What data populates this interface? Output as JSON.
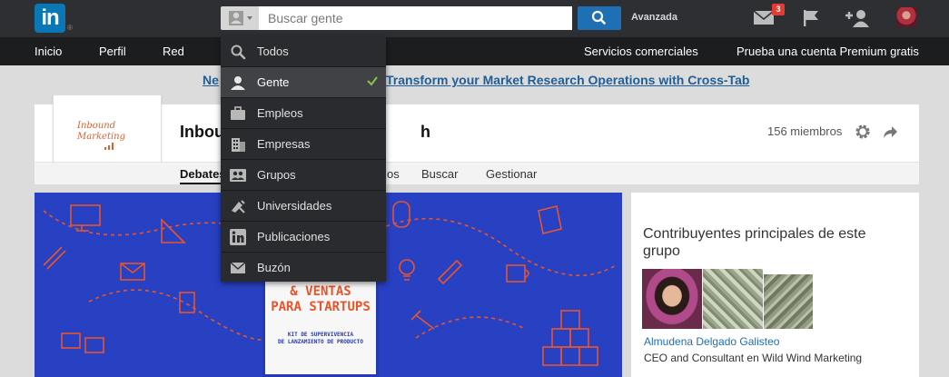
{
  "topbar": {
    "logo_text": "in",
    "logo_mark": "®",
    "search_placeholder": "Buscar gente",
    "advanced_label": "Avanzada",
    "messages_badge": "3",
    "icons": [
      "envelope-icon",
      "flag-icon",
      "add-person-icon",
      "profile-avatar"
    ]
  },
  "nav": {
    "items": [
      "Inicio",
      "Perfil",
      "Red"
    ],
    "right_items": [
      "Servicios comerciales",
      "Prueba una cuenta Premium gratis"
    ]
  },
  "announcement": "Ne... Transform your Market Research Operations with Cross-Tab",
  "announcement_left": "Ne",
  "announcement_right": "Transform your Market Research Operations with Cross-Tab",
  "group": {
    "logo_text": "Inbound\nMarketing",
    "name_prefix": "Inbou",
    "name_suffix": "h",
    "members": "156 miembros",
    "tabs": {
      "debates": "Debates",
      "partial": "os",
      "buscar": "Buscar",
      "gestionar": "Gestionar"
    }
  },
  "banner": {
    "book_title": "& VENTAS\nPARA STARTUPS",
    "book_subtitle": "KIT DE SUPERVIVENCIA\nDE LANZAMIENTO DE PRODUCTO"
  },
  "sidebar": {
    "title": "Contribuyentes principales de este grupo",
    "contributor_name": "Almudena Delgado Galisteo",
    "contributor_role": "CEO and Consultant en Wild Wind Marketing"
  },
  "dropdown": {
    "selected_index": 1,
    "items": [
      {
        "label": "Todos",
        "icon": "search-icon"
      },
      {
        "label": "Gente",
        "icon": "person-icon"
      },
      {
        "label": "Empleos",
        "icon": "briefcase-icon"
      },
      {
        "label": "Empresas",
        "icon": "building-icon"
      },
      {
        "label": "Grupos",
        "icon": "group-icon"
      },
      {
        "label": "Universidades",
        "icon": "university-icon"
      },
      {
        "label": "Publicaciones",
        "icon": "linkedin-icon"
      },
      {
        "label": "Buzón",
        "icon": "mail-icon"
      }
    ]
  },
  "colors": {
    "topbar_bg": "#2d2f33",
    "navbar_bg": "#1c1d1f",
    "linkedin_blue": "#0b77b5",
    "search_button": "#1f6fb4",
    "badge_red": "#e63b31",
    "banner_blue": "#2840c2",
    "accent_orange": "#e8552a",
    "check_green": "#8bc34a"
  }
}
